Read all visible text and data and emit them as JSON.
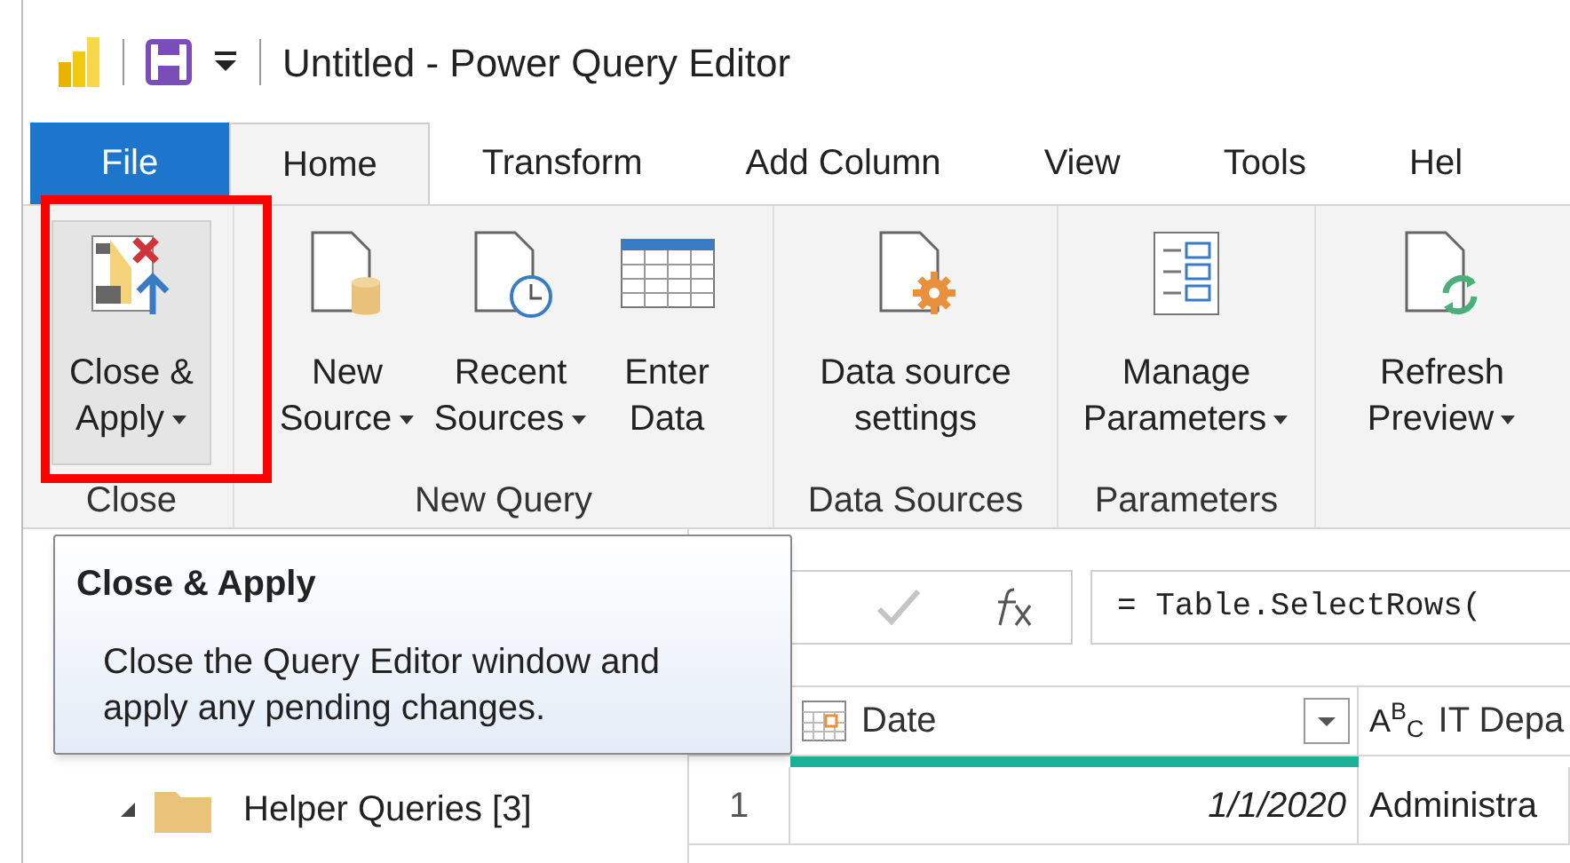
{
  "title_bar": {
    "title": "Untitled - Power Query Editor"
  },
  "tabs": [
    {
      "label": "File",
      "kind": "file",
      "selected": false
    },
    {
      "label": "Home",
      "kind": "tab",
      "selected": true
    },
    {
      "label": "Transform",
      "kind": "tab",
      "selected": false
    },
    {
      "label": "Add Column",
      "kind": "tab",
      "selected": false
    },
    {
      "label": "View",
      "kind": "tab",
      "selected": false
    },
    {
      "label": "Tools",
      "kind": "tab",
      "selected": false
    },
    {
      "label": "Hel",
      "kind": "tab",
      "selected": false
    }
  ],
  "ribbon": {
    "groups": [
      {
        "label": "Close",
        "buttons": [
          {
            "label": "Close & Apply",
            "kind": "close-apply",
            "dropdown": true
          }
        ]
      },
      {
        "label": "New Query",
        "buttons": [
          {
            "label": "New Source",
            "kind": "new-source",
            "dropdown": true
          },
          {
            "label": "Recent Sources",
            "kind": "recent",
            "dropdown": true
          },
          {
            "label": "Enter Data",
            "kind": "table",
            "dropdown": false
          }
        ]
      },
      {
        "label": "Data Sources",
        "buttons": [
          {
            "label": "Data source settings",
            "kind": "settings",
            "dropdown": false
          }
        ]
      },
      {
        "label": "Parameters",
        "buttons": [
          {
            "label": "Manage Parameters",
            "kind": "parameters",
            "dropdown": true
          }
        ]
      },
      {
        "buttons": [
          {
            "label": "Refresh Preview",
            "kind": "refresh",
            "dropdown": true
          }
        ]
      }
    ]
  },
  "tooltip": {
    "title": "Close & Apply",
    "text": "Close the Query Editor window and apply any pending changes."
  },
  "formula_bar": {
    "formula": "= Table.SelectRows("
  },
  "queries": {
    "groups": [
      {
        "label": "Helper Queries [3]",
        "expanded": true
      }
    ]
  },
  "grid": {
    "columns": [
      {
        "label": "Date",
        "kind": "date",
        "filter": true
      },
      {
        "label": "IT Depa",
        "kind": "text",
        "type_label": "A$^{B}$$_{C}$",
        "filter": false
      }
    ],
    "rows": [
      {
        "number": "1",
        "cells": [
          "1/1/2020",
          "Administra"
        ]
      }
    ]
  }
}
